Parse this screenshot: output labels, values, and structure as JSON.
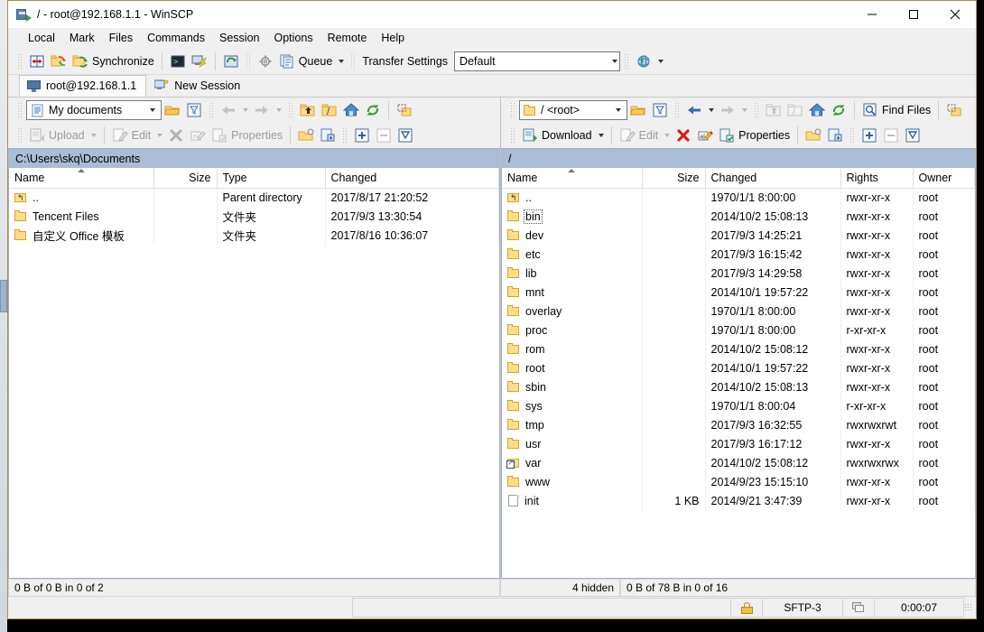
{
  "window": {
    "title": "/ - root@192.168.1.1 - WinSCP",
    "minimize_label": "Minimize",
    "maximize_label": "Maximize",
    "close_label": "Close"
  },
  "menubar": {
    "items": [
      "Local",
      "Mark",
      "Files",
      "Commands",
      "Session",
      "Options",
      "Remote",
      "Help"
    ]
  },
  "toolbar": {
    "synchronize_label": "Synchronize",
    "queue_label": "Queue",
    "transfer_settings_label": "Transfer Settings",
    "transfer_settings_value": "Default"
  },
  "session_tabs": {
    "items": [
      {
        "label": "root@192.168.1.1",
        "icon": "monitor-icon",
        "active": true
      },
      {
        "label": "New Session",
        "icon": "new-session-icon",
        "active": false
      }
    ]
  },
  "local_pane": {
    "drive_combo_value": "My documents",
    "actions": {
      "upload": "Upload",
      "edit": "Edit",
      "properties": "Properties"
    },
    "current_path": "C:\\Users\\skq\\Documents",
    "columns": [
      "Name",
      "Size",
      "Type",
      "Changed"
    ],
    "rows": [
      {
        "icon": "parent-directory-icon",
        "name": "..",
        "size": "",
        "type": "Parent directory",
        "changed": "2017/8/17  21:20:52"
      },
      {
        "icon": "folder-icon",
        "name": "Tencent Files",
        "size": "",
        "type": "文件夹",
        "changed": "2017/9/3  13:30:54"
      },
      {
        "icon": "folder-icon",
        "name": "自定义 Office 模板",
        "size": "",
        "type": "文件夹",
        "changed": "2017/8/16  10:36:07"
      }
    ],
    "status": "0 B of 0 B in 0 of 2"
  },
  "remote_pane": {
    "drive_combo_value": "/ <root>",
    "find_files_label": "Find Files",
    "actions": {
      "download": "Download",
      "edit": "Edit",
      "properties": "Properties"
    },
    "current_path": "/",
    "columns": [
      "Name",
      "Size",
      "Changed",
      "Rights",
      "Owner"
    ],
    "rows": [
      {
        "icon": "parent-directory-icon",
        "name": "..",
        "size": "",
        "changed": "1970/1/1 8:00:00",
        "rights": "rwxr-xr-x",
        "owner": "root",
        "focused": false
      },
      {
        "icon": "folder-icon",
        "name": "bin",
        "size": "",
        "changed": "2014/10/2 15:08:13",
        "rights": "rwxr-xr-x",
        "owner": "root",
        "focused": true
      },
      {
        "icon": "folder-icon",
        "name": "dev",
        "size": "",
        "changed": "2017/9/3 14:25:21",
        "rights": "rwxr-xr-x",
        "owner": "root",
        "focused": false
      },
      {
        "icon": "folder-icon",
        "name": "etc",
        "size": "",
        "changed": "2017/9/3 16:15:42",
        "rights": "rwxr-xr-x",
        "owner": "root",
        "focused": false
      },
      {
        "icon": "folder-icon",
        "name": "lib",
        "size": "",
        "changed": "2017/9/3 14:29:58",
        "rights": "rwxr-xr-x",
        "owner": "root",
        "focused": false
      },
      {
        "icon": "folder-icon",
        "name": "mnt",
        "size": "",
        "changed": "2014/10/1 19:57:22",
        "rights": "rwxr-xr-x",
        "owner": "root",
        "focused": false
      },
      {
        "icon": "folder-icon",
        "name": "overlay",
        "size": "",
        "changed": "1970/1/1 8:00:00",
        "rights": "rwxr-xr-x",
        "owner": "root",
        "focused": false
      },
      {
        "icon": "folder-icon",
        "name": "proc",
        "size": "",
        "changed": "1970/1/1 8:00:00",
        "rights": "r-xr-xr-x",
        "owner": "root",
        "focused": false
      },
      {
        "icon": "folder-icon",
        "name": "rom",
        "size": "",
        "changed": "2014/10/2 15:08:12",
        "rights": "rwxr-xr-x",
        "owner": "root",
        "focused": false
      },
      {
        "icon": "folder-icon",
        "name": "root",
        "size": "",
        "changed": "2014/10/1 19:57:22",
        "rights": "rwxr-xr-x",
        "owner": "root",
        "focused": false
      },
      {
        "icon": "folder-icon",
        "name": "sbin",
        "size": "",
        "changed": "2014/10/2 15:08:13",
        "rights": "rwxr-xr-x",
        "owner": "root",
        "focused": false
      },
      {
        "icon": "folder-icon",
        "name": "sys",
        "size": "",
        "changed": "1970/1/1 8:00:04",
        "rights": "r-xr-xr-x",
        "owner": "root",
        "focused": false
      },
      {
        "icon": "folder-icon",
        "name": "tmp",
        "size": "",
        "changed": "2017/9/3 16:32:55",
        "rights": "rwxrwxrwt",
        "owner": "root",
        "focused": false
      },
      {
        "icon": "folder-icon",
        "name": "usr",
        "size": "",
        "changed": "2017/9/3 16:17:12",
        "rights": "rwxr-xr-x",
        "owner": "root",
        "focused": false
      },
      {
        "icon": "symlink-icon",
        "name": "var",
        "size": "",
        "changed": "2014/10/2 15:08:12",
        "rights": "rwxrwxrwx",
        "owner": "root",
        "focused": false
      },
      {
        "icon": "folder-icon",
        "name": "www",
        "size": "",
        "changed": "2014/9/23 15:15:10",
        "rights": "rwxr-xr-x",
        "owner": "root",
        "focused": false
      },
      {
        "icon": "file-icon",
        "name": "init",
        "size": "1 KB",
        "changed": "2014/9/21 3:47:39",
        "rights": "rwxr-xr-x",
        "owner": "root",
        "focused": false
      }
    ],
    "hidden_count": "4 hidden",
    "status": "0 B of 78 B in 0 of 16"
  },
  "bottom_bar": {
    "protocol": "SFTP-3",
    "elapsed": "0:00:07"
  },
  "colors": {
    "window_border": "#b08d4f",
    "path_header_bg": "#a9bdd4",
    "toolbar_bg": "#f0f0f0",
    "list_bg": "#ffffff"
  }
}
